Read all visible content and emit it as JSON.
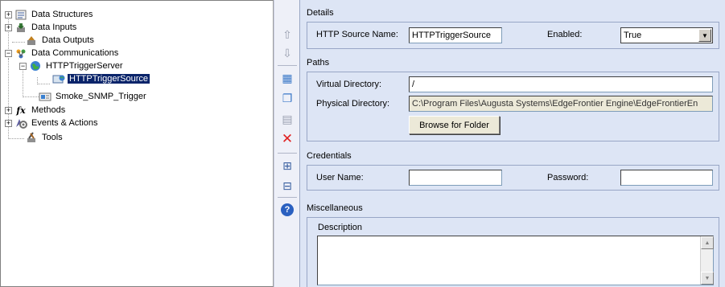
{
  "tree": {
    "items": [
      {
        "label": "Data Structures",
        "expander": "+",
        "icon": "data-structures-icon"
      },
      {
        "label": "Data Inputs",
        "expander": "+",
        "icon": "data-inputs-icon"
      },
      {
        "label": "Data Outputs",
        "expander": "",
        "icon": "data-outputs-icon"
      },
      {
        "label": "Data Communications",
        "expander": "−",
        "icon": "data-communications-icon"
      },
      {
        "label": "HTTPTriggerServer",
        "expander": "−",
        "icon": "globe-icon"
      },
      {
        "label": "HTTPTriggerSource",
        "expander": "",
        "icon": "http-source-icon",
        "selected": true
      },
      {
        "label": "Smoke_SNMP_Trigger",
        "expander": "",
        "icon": "snmp-trigger-icon"
      },
      {
        "label": "Methods",
        "expander": "+",
        "icon": "function-icon",
        "icon_glyph": "fx"
      },
      {
        "label": "Events & Actions",
        "expander": "+",
        "icon": "events-actions-icon"
      },
      {
        "label": "Tools",
        "expander": "",
        "icon": "tools-icon"
      }
    ]
  },
  "toolbar": {
    "buttons": [
      {
        "name": "move-up-icon",
        "glyph": "⇧",
        "color": "#9aa0b0"
      },
      {
        "name": "move-down-icon",
        "glyph": "⇩",
        "color": "#9aa0b0"
      },
      {
        "name": "add-child-icon",
        "glyph": "▦",
        "color": "#3a78c8"
      },
      {
        "name": "copy-icon",
        "glyph": "❐",
        "color": "#3a78c8"
      },
      {
        "name": "paste-icon",
        "glyph": "▤",
        "color": "#9aa0b0"
      },
      {
        "name": "delete-icon",
        "glyph": "✕",
        "color": "#e02020"
      },
      {
        "name": "expand-all-icon",
        "glyph": "⊞",
        "color": "#3a5fa0"
      },
      {
        "name": "collapse-all-icon",
        "glyph": "⊟",
        "color": "#3a5fa0"
      },
      {
        "name": "help-icon",
        "glyph": "?",
        "color": "#ffffff"
      }
    ]
  },
  "details": {
    "section_title": "Details",
    "source_name_label": "HTTP Source Name:",
    "source_name_value": "HTTPTriggerSource",
    "enabled_label": "Enabled:",
    "enabled_value": "True"
  },
  "paths": {
    "section_title": "Paths",
    "virtual_dir_label": "Virtual Directory:",
    "virtual_dir_value": "/",
    "physical_dir_label": "Physical Directory:",
    "physical_dir_value": "C:\\Program Files\\Augusta Systems\\EdgeFrontier Engine\\EdgeFrontierEn",
    "browse_button": "Browse for Folder"
  },
  "credentials": {
    "section_title": "Credentials",
    "user_name_label": "User Name:",
    "user_name_value": "",
    "password_label": "Password:",
    "password_value": ""
  },
  "miscellaneous": {
    "section_title": "Miscellaneous",
    "description_label": "Description",
    "description_value": ""
  },
  "colors": {
    "panel_bg": "#dde5f5",
    "toolbar_bg": "#eef0f8",
    "selection": "#0a246a"
  }
}
